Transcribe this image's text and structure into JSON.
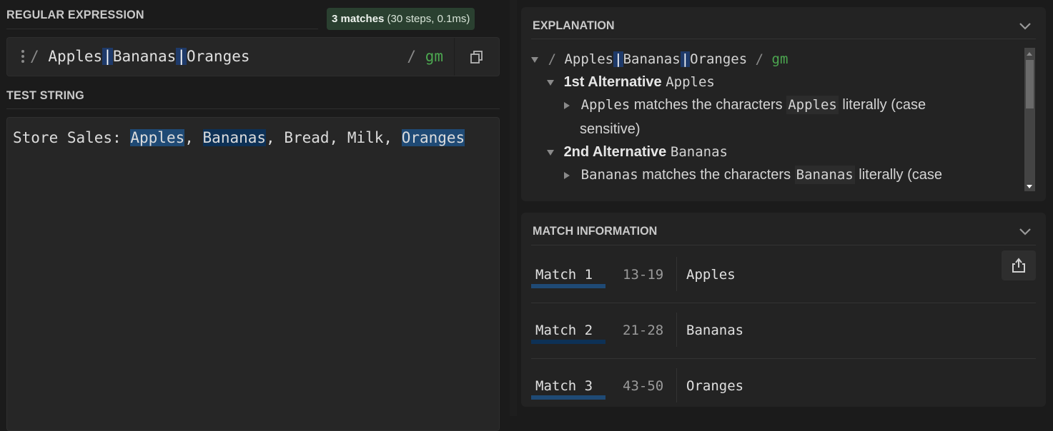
{
  "regex": {
    "section_label": "REGULAR EXPRESSION",
    "match_summary": {
      "count": "3 matches",
      "detail": "(30 steps, 0.1ms)"
    },
    "open_delimiter": "/",
    "alternatives": [
      "Apples",
      "Bananas",
      "Oranges"
    ],
    "alternation_char": "|",
    "close_delimiter": "/",
    "flags": "gm",
    "drag_handle_icon": "vertical-dots-icon",
    "copy_icon": "copy-icon"
  },
  "test_string": {
    "section_label": "TEST STRING",
    "segments": [
      {
        "text": "Store Sales: ",
        "match": 0
      },
      {
        "text": "Apples",
        "match": 1
      },
      {
        "text": ", ",
        "match": 0
      },
      {
        "text": "Bananas",
        "match": 2
      },
      {
        "text": ", Bread, Milk, ",
        "match": 0
      },
      {
        "text": "Oranges",
        "match": 3
      }
    ]
  },
  "explanation": {
    "title": "EXPLANATION",
    "collapse_icon": "chevron-down-icon",
    "root": {
      "open_delimiter": "/",
      "pattern_parts": [
        "Apples",
        "Bananas",
        "Oranges"
      ],
      "alternation_char": "|",
      "close_delimiter": "/",
      "flags": "gm"
    },
    "alternatives": [
      {
        "heading": "1st Alternative",
        "token": "Apples",
        "detail_token": "Apples",
        "detail_mid": "matches the characters",
        "detail_literal": "Apples",
        "detail_tail": "literally (case",
        "detail_wrap": "sensitive)"
      },
      {
        "heading": "2nd Alternative",
        "token": "Bananas",
        "detail_token": "Bananas",
        "detail_mid": "matches the characters",
        "detail_literal": "Bananas",
        "detail_tail": "literally (case"
      }
    ]
  },
  "match_information": {
    "title": "MATCH INFORMATION",
    "collapse_icon": "chevron-down-icon",
    "export_icon": "export-icon",
    "matches": [
      {
        "label": "Match 1",
        "range": "13-19",
        "value": "Apples"
      },
      {
        "label": "Match 2",
        "range": "21-28",
        "value": "Bananas"
      },
      {
        "label": "Match 3",
        "range": "43-50",
        "value": "Oranges"
      }
    ]
  },
  "colors": {
    "background": "#1b1b1b",
    "panel": "#232323",
    "input": "#262626",
    "badge": "#2a4030",
    "flags": "#4ca750",
    "alternation_highlight": "#1e3a6a",
    "match_highlight_odd": "#1f4a75",
    "match_highlight_even": "#0d3156"
  }
}
